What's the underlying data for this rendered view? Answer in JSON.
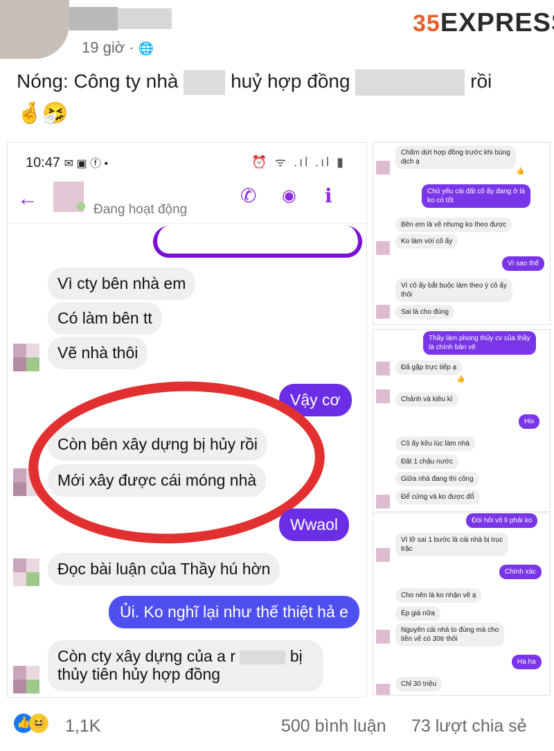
{
  "post": {
    "time": "19 giờ",
    "separator": "·",
    "globe_icon": "🌐",
    "text_part1": "Nóng: Công ty nhà",
    "text_part2": "huỷ hợp đồng",
    "text_part3": "rồi",
    "emojis": "🤞🤧"
  },
  "logo": {
    "number": "35",
    "word": "EXPRESS"
  },
  "phone": {
    "time": "10:47",
    "status_left_icons": "✉ ▣ ⓕ •",
    "status_right_icons": "⏰ ᯤ .ıl .ıl ▮",
    "back_icon": "←",
    "active_status": "Đang hoạt động",
    "phone_icon": "✆",
    "video_icon": "◉",
    "info_icon": "ℹ",
    "messages_in": [
      "Vì cty bên nhà em",
      "Có làm bên tt",
      "Vẽ nhà thôi",
      "Còn bên xây dựng bị hủy rồi",
      "Mới xây được cái móng nhà",
      "Đọc bài luận của Thầy hú hờn",
      "Còn cty xây dựng của a r",
      "bị",
      "thủy tiên hủy hợp đồng"
    ],
    "messages_out": [
      "Vậy cơ",
      "Wwaol",
      "Ủi. Ko nghĩ lại như thế thiệt hả e"
    ]
  },
  "right_top": {
    "in": [
      "Chấm dứt hợp đồng trước khi bùng",
      "dịch ạ",
      "Bên em là vẽ nhưng ko theo được",
      "Ko làm với cô ấy",
      "Vì cô ấy bắt buộc làm theo ý cô ấy",
      "thôi",
      "Sai là cho đúng"
    ],
    "out": [
      "Chủ yếu cái đất cô ấy đang ở là",
      "ko có tốt",
      "Vì sao thế"
    ]
  },
  "right_mid": {
    "out": [
      "Thầy làm phong thủy cv của thầy",
      "là chính bản vẽ",
      "Hix"
    ],
    "in": [
      "Đã gặp trực tiếp ạ",
      "Chảnh và kiêu kì",
      "Cô ấy kêu lúc làm nhà",
      "Đặt 1 chậu nước",
      "Giữa nhà đang thi công",
      "Để cứng và ko được đổ"
    ]
  },
  "right_bot": {
    "out": [
      "Đòi hỏi vô lí phải ko",
      "Chính xác",
      "Ha ha"
    ],
    "in": [
      "Vì lỡ sai 1 bước là cái nhà bị trục",
      "trặc",
      "Cho nên là ko nhận vẽ ạ",
      "Ép giá nữa",
      "Nguyên cái nhà to đùng mà cho",
      "tiền vẽ có 30tr thôi",
      "Chỉ 30 triệu"
    ]
  },
  "footer": {
    "like_icon": "👍",
    "haha_icon": "😆",
    "reaction_count": "1,1K",
    "comments": "500 bình luận",
    "shares": "73 lượt chia sẻ"
  }
}
